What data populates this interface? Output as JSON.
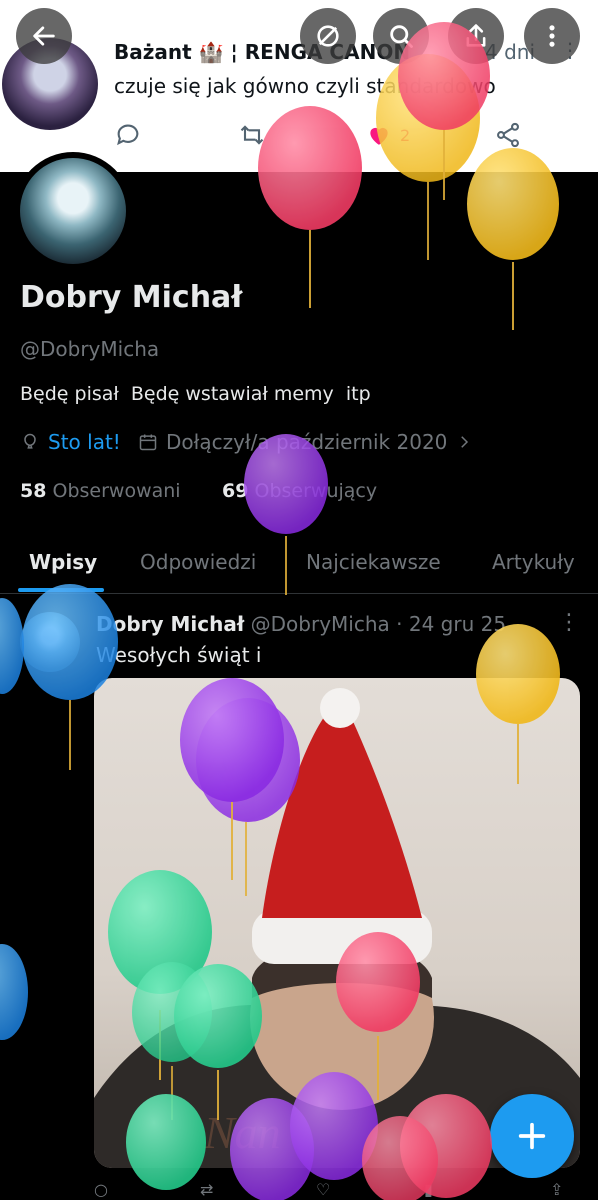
{
  "header_buttons": {
    "back": "back-arrow-icon",
    "grok": "grok-icon",
    "search": "search-icon",
    "share": "share-icon",
    "more": "more-vertical-icon"
  },
  "peek_tweet": {
    "author": "Bażant 🏰 ¦ RENGA CANON",
    "time": "4 dni",
    "text": "czuje się jak gówno czyli standardowo",
    "likes": "2"
  },
  "profile": {
    "display_name": "Dobry Michał",
    "handle": "@DobryMicha",
    "bio": "Będę pisał  Będę wstawiał memy  itp",
    "birthday_link": "Sto lat!",
    "joined": "Dołączył/a październik 2020",
    "following_count": "58",
    "following_label": "Obserwowani",
    "followers_count": "69",
    "followers_label": "Obserwujący"
  },
  "tabs": [
    "Wpisy",
    "Odpowiedzi",
    "Najciekawsze",
    "Artykuły"
  ],
  "tweet": {
    "name": "Dobry Michał",
    "handle": "@DobryMicha",
    "time": "24 gru 25",
    "text": "Wesołych świąt i",
    "media_caption": "Nan"
  },
  "colors": {
    "accent": "#1d9bf0",
    "background": "#000000",
    "like": "#f91880"
  }
}
